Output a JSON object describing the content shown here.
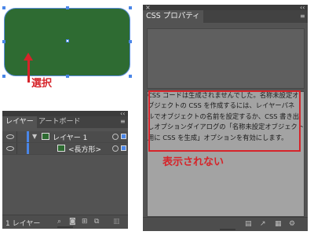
{
  "colors": {
    "shape_fill": "#2e6b32",
    "selection": "#4a86e8",
    "annotation": "#d6242a"
  },
  "canvas": {
    "annotation_label": "選択"
  },
  "layers_panel": {
    "tabs": [
      "レイヤー",
      "アートボード"
    ],
    "menu_icon": "panel-menu-icon",
    "collapse_icon": "double-chevron-icon",
    "rows": [
      {
        "name": "レイヤー 1",
        "expanded": true
      },
      {
        "name": "<長方形>"
      }
    ],
    "footer_label": "1 レイヤー",
    "footer_icons": [
      "locate-object-icon",
      "make-clipping-mask-icon",
      "create-sublayer-icon",
      "create-layer-icon",
      "delete-icon"
    ]
  },
  "css_panel": {
    "close_icon": "close-icon",
    "collapse_icon": "double-chevron-icon",
    "title": "CSS プロパティ",
    "menu_icon": "panel-menu-icon",
    "message_lines": [
      "CSS コードは生成されませんでした。名称未設定オ",
      "ブジェクトの CSS を作成するには、レイヤーパネ",
      "ルでオブジェクトの名前を設定するか、CSS 書き出",
      "しオプションダイアログの「名称未設定オブジェクト",
      "用に CSS を生成」オプションを有効にします。"
    ],
    "annotation_label": "表示されない",
    "footer_icons": [
      "export-css-icon",
      "copy-style-icon",
      "generate-css-icon",
      "export-options-icon"
    ]
  }
}
